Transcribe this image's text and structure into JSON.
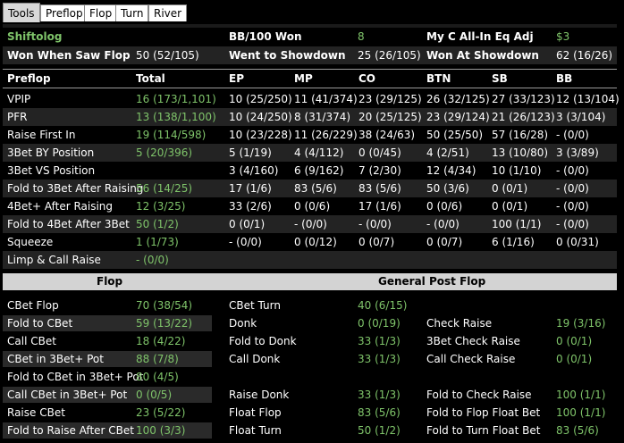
{
  "tabs": [
    "Tools",
    "Preflop",
    "Flop",
    "Turn",
    "River"
  ],
  "summary": {
    "row1": {
      "label": "Shiftolog",
      "bb100_label": "BB/100  Won",
      "bb100_value": "8",
      "allin_label": "My C All-In Eq Adj",
      "allin_value": "$3"
    },
    "row2": {
      "wwsf_label": "Won When Saw Flop",
      "wwsf_value": "50 (52/105)",
      "wtsd_label": "Went to Showdown",
      "wtsd_value": "25 (26/105)",
      "wsd_label": "Won At Showdown",
      "wsd_value": "62 (16/26)"
    }
  },
  "preflop": {
    "headers": [
      "Preflop",
      "Total",
      "EP",
      "MP",
      "CO",
      "BTN",
      "SB",
      "BB"
    ],
    "rows": [
      {
        "label": "VPIP",
        "cells": [
          "16 (173/1,101)",
          "10 (25/250)",
          "11 (41/374)",
          "23 (29/125)",
          "26 (32/125)",
          "27 (33/123)",
          "12 (13/104)"
        ]
      },
      {
        "label": "PFR",
        "cells": [
          "13 (138/1,100)",
          "10 (24/250)",
          "8 (31/374)",
          "20 (25/125)",
          "23 (29/124)",
          "21 (26/123)",
          "3 (3/104)"
        ]
      },
      {
        "label": "Raise First In",
        "cells": [
          "19 (114/598)",
          "10 (23/228)",
          "11 (26/229)",
          "38 (24/63)",
          "50 (25/50)",
          "57 (16/28)",
          "- (0/0)"
        ]
      },
      {
        "label": "3Bet BY Position",
        "cells": [
          "5 (20/396)",
          "5 (1/19)",
          "4 (4/112)",
          "0 (0/45)",
          "4 (2/51)",
          "13 (10/80)",
          "3 (3/89)"
        ]
      },
      {
        "label": "3Bet VS Position",
        "cells": [
          "",
          "3 (4/160)",
          "6 (9/162)",
          "7 (2/30)",
          "12 (4/34)",
          "10 (1/10)",
          "- (0/0)"
        ]
      },
      {
        "label": "Fold to 3Bet After Raising",
        "cells": [
          "56 (14/25)",
          "17 (1/6)",
          "83 (5/6)",
          "83 (5/6)",
          "50 (3/6)",
          "0 (0/1)",
          "- (0/0)"
        ]
      },
      {
        "label": "4Bet+ After Raising",
        "cells": [
          "12 (3/25)",
          "33 (2/6)",
          "0 (0/6)",
          "17 (1/6)",
          "0 (0/6)",
          "0 (0/1)",
          "- (0/0)"
        ]
      },
      {
        "label": "Fold to 4Bet After 3Bet",
        "cells": [
          "50 (1/2)",
          "0 (0/1)",
          "- (0/0)",
          "- (0/0)",
          "- (0/0)",
          "100 (1/1)",
          "- (0/0)"
        ]
      },
      {
        "label": "Squeeze",
        "cells": [
          "1 (1/73)",
          "- (0/0)",
          "0 (0/12)",
          "0 (0/7)",
          "0 (0/7)",
          "6 (1/16)",
          "0 (0/31)"
        ]
      },
      {
        "label": "Limp & Call Raise",
        "cells": [
          "- (0/0)",
          "",
          "",
          "",
          "",
          "",
          ""
        ]
      }
    ]
  },
  "postflop": {
    "flop_header": "Flop",
    "general_header": "General Post Flop",
    "rows": [
      {
        "l1": "CBet Flop",
        "v1": "70 (38/54)",
        "l2": "CBet Turn",
        "v2": "40 (6/15)",
        "l3": "",
        "v3": ""
      },
      {
        "l1": "Fold to CBet",
        "v1": "59 (13/22)",
        "l2": "Donk",
        "v2": "0 (0/19)",
        "l3": "Check Raise",
        "v3": "19 (3/16)"
      },
      {
        "l1": "Call CBet",
        "v1": "18 (4/22)",
        "l2": "Fold to Donk",
        "v2": "33 (1/3)",
        "l3": "3Bet Check Raise",
        "v3": "0 (0/1)"
      },
      {
        "l1": "CBet in 3Bet+ Pot",
        "v1": "88 (7/8)",
        "l2": "Call Donk",
        "v2": "33 (1/3)",
        "l3": "Call Check Raise",
        "v3": "0 (0/1)"
      },
      {
        "l1": "Fold to CBet in 3Bet+ Pot",
        "v1": "80 (4/5)",
        "l2": "",
        "v2": "",
        "l3": "",
        "v3": ""
      },
      {
        "l1": "Call CBet in 3Bet+ Pot",
        "v1": "0 (0/5)",
        "l2": "Raise Donk",
        "v2": "33 (1/3)",
        "l3": "Fold to Check Raise",
        "v3": "100 (1/1)"
      },
      {
        "l1": "Raise CBet",
        "v1": "23 (5/22)",
        "l2": "Float Flop",
        "v2": "83 (5/6)",
        "l3": "Fold to Flop Float Bet",
        "v3": "100 (1/1)"
      },
      {
        "l1": "Fold to Raise After CBet",
        "v1": "100 (3/3)",
        "l2": "Float Turn",
        "v2": "50 (1/2)",
        "l3": "Fold to Turn Float Bet",
        "v3": "83 (5/6)"
      }
    ]
  },
  "colors": {
    "accent_green": "#7fc46a",
    "header_bg": "#d3d3d3",
    "row_dark": "#232323"
  }
}
